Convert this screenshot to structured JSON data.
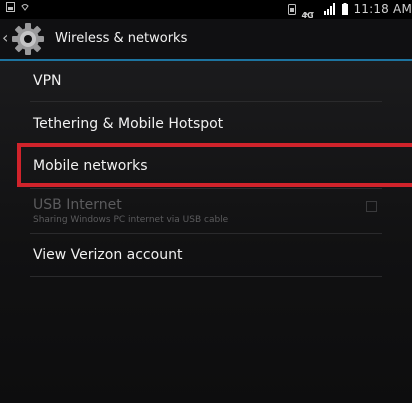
{
  "status_bar": {
    "time": "11:18 AM",
    "network": "4G",
    "icons": [
      "screenshot-icon",
      "wifi-icon",
      "sim-icon",
      "signal-icon",
      "battery-icon"
    ]
  },
  "action_bar": {
    "title": "Wireless & networks",
    "icon": "gear-icon",
    "accent_color": "#1d74a0"
  },
  "settings": {
    "items": [
      {
        "label": "VPN"
      },
      {
        "label": "Tethering & Mobile Hotspot"
      },
      {
        "label": "Mobile networks",
        "highlighted": true
      },
      {
        "label": "USB Internet",
        "subtitle": "Sharing Windows PC internet via USB cable",
        "enabled": false,
        "checked": false
      },
      {
        "label": "View Verizon account"
      }
    ],
    "highlight_color": "#d0232b"
  }
}
